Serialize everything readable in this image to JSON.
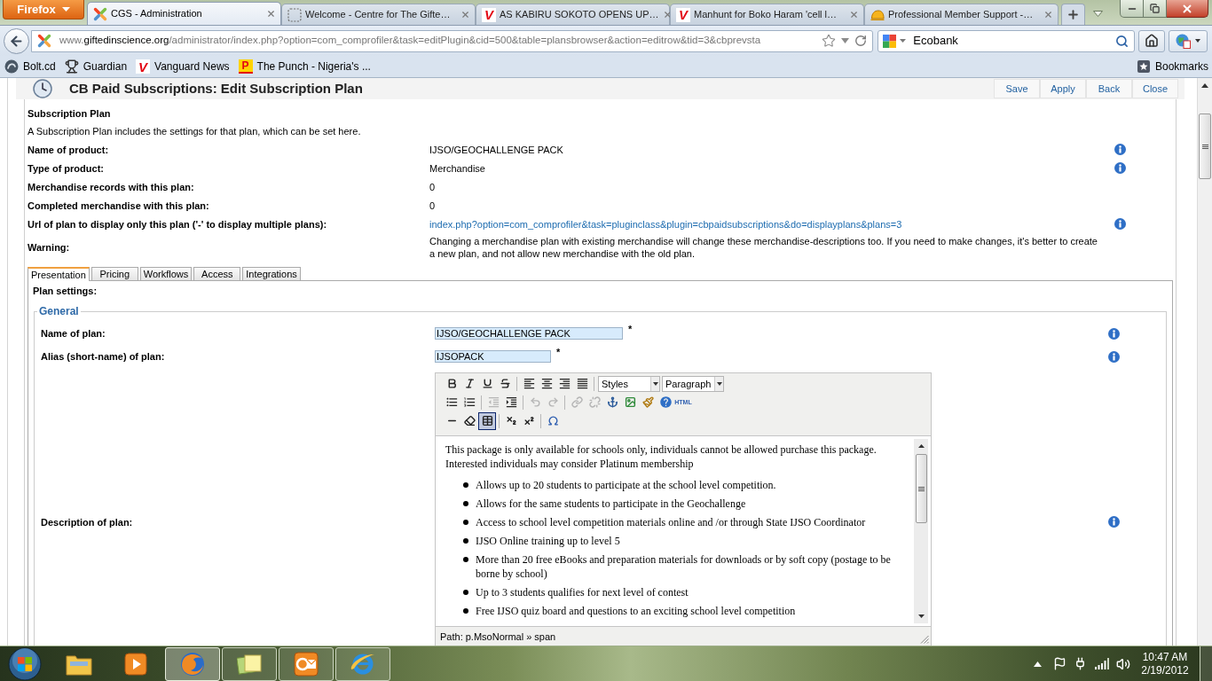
{
  "browser": {
    "menu_button": "Firefox",
    "tabs": [
      {
        "title": "CGS - Administration",
        "selected": true,
        "icon": {
          "kind": "pinwheel"
        }
      },
      {
        "title": "Welcome - Centre for The Gifte…",
        "selected": false,
        "icon": {
          "kind": "dashed"
        }
      },
      {
        "title": "AS KABIRU SOKOTO OPENS UP…",
        "selected": false,
        "icon": {
          "kind": "letter",
          "letter": "V"
        }
      },
      {
        "title": "Manhunt for Boko Haram 'cell l…",
        "selected": false,
        "icon": {
          "kind": "letter",
          "letter": "V"
        }
      },
      {
        "title": "Professional Member Support -…",
        "selected": false,
        "icon": {
          "kind": "helmet"
        }
      }
    ],
    "address": {
      "icon": {
        "kind": "pinwheel"
      },
      "prefix": "www.",
      "domain": "giftedinscience.org",
      "path": "/administrator/index.php?option=com_comprofiler&task=editPlugin&cid=500&table=plansbrowser&action=editrow&tid=3&cbprevsta"
    },
    "search": {
      "value": "Ecobank"
    },
    "bookmarks": [
      {
        "label": "Bolt.cd",
        "icon": {
          "kind": "disc"
        }
      },
      {
        "label": "Guardian",
        "icon": {
          "kind": "trophy"
        }
      },
      {
        "label": "Vanguard News",
        "icon": {
          "kind": "letter",
          "letter": "V"
        }
      },
      {
        "label": "The Punch - Nigeria's ...",
        "icon": {
          "kind": "tile",
          "letter": "P"
        }
      }
    ],
    "bookmarks_menu": "Bookmarks"
  },
  "page": {
    "title": "CB Paid Subscriptions: Edit Subscription Plan",
    "actions": [
      "Save",
      "Apply",
      "Back",
      "Close"
    ],
    "plan": {
      "heading": "Subscription Plan",
      "intro": "A Subscription Plan includes the settings for that plan, which can be set here.",
      "rows": [
        {
          "label": "Name of product:",
          "kind": "text",
          "value": "IJSO/GEOCHALLENGE PACK",
          "info": true
        },
        {
          "label": "Type of product:",
          "kind": "text",
          "value": "Merchandise",
          "info": true
        },
        {
          "label": "Merchandise records with this plan:",
          "kind": "text",
          "value": "0",
          "info": false
        },
        {
          "label": "Completed merchandise with this plan:",
          "kind": "text",
          "value": "0",
          "info": false
        },
        {
          "label": "Url of plan to display only this plan ('-' to display multiple plans):",
          "kind": "link",
          "value": "index.php?option=com_comprofiler&task=pluginclass&plugin=cbpaidsubscriptions&do=displayplans&plans=3",
          "info": true
        },
        {
          "label": "Warning:",
          "kind": "text",
          "value": "Changing a merchandise plan with existing merchandise will change these merchandise-descriptions too. If you need to make changes, it's better to create a new plan, and not allow new merchandise with the old plan.",
          "info": false
        }
      ]
    },
    "tabs": [
      {
        "label": "Presentation",
        "selected": true
      },
      {
        "label": "Pricing",
        "selected": false
      },
      {
        "label": "Workflows",
        "selected": false
      },
      {
        "label": "Access",
        "selected": false
      },
      {
        "label": "Integrations",
        "selected": false
      }
    ],
    "settings": {
      "heading": "Plan settings:",
      "legend": "General",
      "fields": [
        {
          "kind": "wide-input",
          "label": "Name of plan:",
          "value": "IJSO/GEOCHALLENGE PACK",
          "mark": "*",
          "info": true
        },
        {
          "kind": "narrow-input",
          "label": "Alias (short-name) of plan:",
          "value": "IJSOPACK",
          "mark": "*",
          "info": true
        },
        {
          "kind": "editor",
          "label": "Description of plan:",
          "info": true
        }
      ]
    },
    "editor": {
      "toolbar": [
        [
          [
            {
              "kind": "bold",
              "disabled": false,
              "active": false
            },
            {
              "kind": "italic",
              "disabled": false,
              "active": false
            },
            {
              "kind": "underline",
              "disabled": false,
              "active": false
            },
            {
              "kind": "strike",
              "disabled": false,
              "active": false
            }
          ],
          [
            {
              "kind": "align-left",
              "disabled": false,
              "active": false
            },
            {
              "kind": "align-center",
              "disabled": false,
              "active": false
            },
            {
              "kind": "align-right",
              "disabled": false,
              "active": false
            },
            {
              "kind": "justify",
              "disabled": false,
              "active": false
            }
          ],
          [
            {
              "kind": "select",
              "value": "Styles"
            },
            {
              "kind": "select",
              "value": "Paragraph"
            }
          ]
        ],
        [
          [
            {
              "kind": "bullets",
              "disabled": false,
              "active": false
            },
            {
              "kind": "numbers",
              "disabled": false,
              "active": false
            }
          ],
          [
            {
              "kind": "outdent",
              "disabled": true,
              "active": false
            },
            {
              "kind": "indent",
              "disabled": false,
              "active": false
            }
          ],
          [
            {
              "kind": "undo",
              "disabled": true,
              "active": false
            },
            {
              "kind": "redo",
              "disabled": true,
              "active": false
            }
          ],
          [
            {
              "kind": "link",
              "disabled": true,
              "active": false
            },
            {
              "kind": "unlink",
              "disabled": true,
              "active": false
            },
            {
              "kind": "anchor",
              "disabled": false,
              "active": false
            },
            {
              "kind": "image",
              "disabled": false,
              "active": false
            },
            {
              "kind": "cleanup",
              "disabled": false,
              "active": false
            },
            {
              "kind": "help",
              "disabled": false,
              "active": false
            },
            {
              "kind": "html",
              "label": "HTML",
              "disabled": false,
              "active": false
            }
          ]
        ],
        [
          [
            {
              "kind": "rule",
              "disabled": false,
              "active": false
            },
            {
              "kind": "eraser",
              "disabled": false,
              "active": false
            },
            {
              "kind": "table",
              "disabled": false,
              "active": true
            }
          ],
          [
            {
              "kind": "sub",
              "disabled": false,
              "active": false
            },
            {
              "kind": "sup",
              "disabled": false,
              "active": false
            }
          ],
          [
            {
              "kind": "charmap",
              "disabled": false,
              "active": false
            }
          ]
        ]
      ],
      "paragraph": "This package is only available for schools only, individuals cannot be allowed purchase this package. Interested individuals may consider Platinum membership",
      "bullets": [
        "Allows up to 20 students to participate at the school level competition.",
        "Allows for the same students to participate in the Geochallenge",
        "Access to school level competition materials online and /or through State IJSO Coordinator",
        "IJSO Online training up to level 5",
        "More than 20 free eBooks and preparation materials for downloads or by soft copy (postage to be borne by school)",
        "Up to 3 students qualifies for next level of contest",
        "Free IJSO quiz board and questions to an exciting school level competition"
      ],
      "path": "Path: p.MsoNormal » span"
    }
  },
  "taskbar": {
    "apps": [
      {
        "kind": "folder",
        "running": false,
        "active": false
      },
      {
        "kind": "media",
        "running": false,
        "active": false
      },
      {
        "kind": "globe",
        "running": true,
        "active": true
      },
      {
        "kind": "notes",
        "running": true,
        "active": false
      },
      {
        "kind": "mail",
        "running": true,
        "active": false
      },
      {
        "kind": "ring",
        "running": true,
        "active": false
      }
    ],
    "time": "10:47 AM",
    "date": "2/19/2012"
  }
}
